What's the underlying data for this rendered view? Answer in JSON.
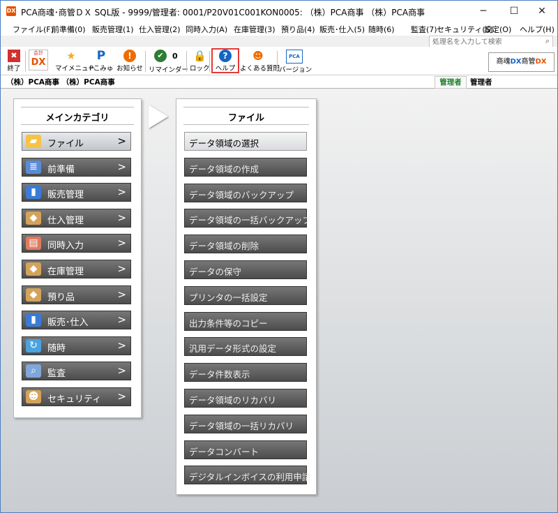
{
  "window": {
    "title": "PCA商魂･商管ＤＸ SQL版 - 9999/管理者: 0001/P20V01C001KON0005: （株）PCA商事 （株）PCA商事",
    "app_icon": "DX",
    "controls": {
      "minimize": "─",
      "maximize": "☐",
      "close": "✕"
    }
  },
  "menu": [
    "ファイル(F)",
    "前準備(0)",
    "販売管理(1)",
    "仕入管理(2)",
    "同時入力(A)",
    "在庫管理(3)",
    "預り品(4)",
    "販売･仕入(5)",
    "随時(6)",
    "監査(7)",
    "セキュリティ(S)",
    "設定(O)",
    "ヘルプ(H)"
  ],
  "search": {
    "placeholder": "処理名を入力して検索",
    "icon": "search-icon"
  },
  "toolbar": [
    {
      "key": "exit",
      "label": "終了",
      "icon": "close-icon",
      "color": "#d32f2f"
    },
    {
      "key": "kaikei",
      "label": "",
      "icon": "kaikei-dx-icon",
      "color": "#e65100"
    },
    {
      "key": "my-menu",
      "label": "マイメニュー",
      "icon": "star-icon",
      "color": "#f9a825"
    },
    {
      "key": "pcomyu",
      "label": "Pこみゅ",
      "icon": "p-icon",
      "color": "#1565c0"
    },
    {
      "key": "notice",
      "label": "お知らせ",
      "icon": "alert-icon",
      "color": "#ef6c00"
    },
    {
      "key": "reminder",
      "label": "リマインダー",
      "icon": "check-icon",
      "color": "#2e7d32"
    },
    {
      "key": "lock",
      "label": "ロック",
      "icon": "lock-icon",
      "color": "#f9a825"
    },
    {
      "key": "help",
      "label": "ヘルプ",
      "icon": "question-icon",
      "color": "#1565c0"
    },
    {
      "key": "faq",
      "label": "よくある質問",
      "icon": "person-icon",
      "color": "#ef6c00"
    },
    {
      "key": "version",
      "label": "バージョン",
      "icon": "pca-icon",
      "color": "#1565c0"
    }
  ],
  "reminder_count": "0",
  "kaikei_label": "会計",
  "kaikei_dx": "DX",
  "pca_label": "PCA",
  "logo": {
    "left": "商魂",
    "dx": "DX",
    "right": "商管",
    "dx2": "DX"
  },
  "company": "（株）PCA商事 （株）PCA商事",
  "role": "管理者",
  "user": "管理者",
  "main_category": {
    "title": "メインカテゴリ",
    "items": [
      {
        "label": "ファイル",
        "icon": "folder-icon",
        "color": "#f6c343",
        "active": true
      },
      {
        "label": "前準備",
        "icon": "list-icon",
        "color": "#5b8bd6"
      },
      {
        "label": "販売管理",
        "icon": "bar-chart-icon",
        "color": "#3a7bd5"
      },
      {
        "label": "仕入管理",
        "icon": "box-icon",
        "color": "#d4a35a"
      },
      {
        "label": "同時入力",
        "icon": "form-icon",
        "color": "#e07a5f"
      },
      {
        "label": "在庫管理",
        "icon": "boxes-icon",
        "color": "#d4a35a"
      },
      {
        "label": "預り品",
        "icon": "package-icon",
        "color": "#d4a35a"
      },
      {
        "label": "販売･仕入",
        "icon": "sales-icon",
        "color": "#3a7bd5"
      },
      {
        "label": "随時",
        "icon": "refresh-icon",
        "color": "#4aa3df"
      },
      {
        "label": "監査",
        "icon": "magnifier-icon",
        "color": "#7fa7d9"
      },
      {
        "label": "セキュリティ",
        "icon": "users-icon",
        "color": "#d4a35a"
      }
    ]
  },
  "file_menu": {
    "title": "ファイル",
    "items": [
      "データ領域の選択",
      "データ領域の作成",
      "データ領域のバックアップ",
      "データ領域の一括バックアップ",
      "データ領域の削除",
      "データの保守",
      "プリンタの一括設定",
      "出力条件等のコピー",
      "汎用データ形式の設定",
      "データ件数表示",
      "データ領域のリカバリ",
      "データ領域の一括リカバリ",
      "データコンバート",
      "デジタルインボイスの利用申請"
    ]
  }
}
